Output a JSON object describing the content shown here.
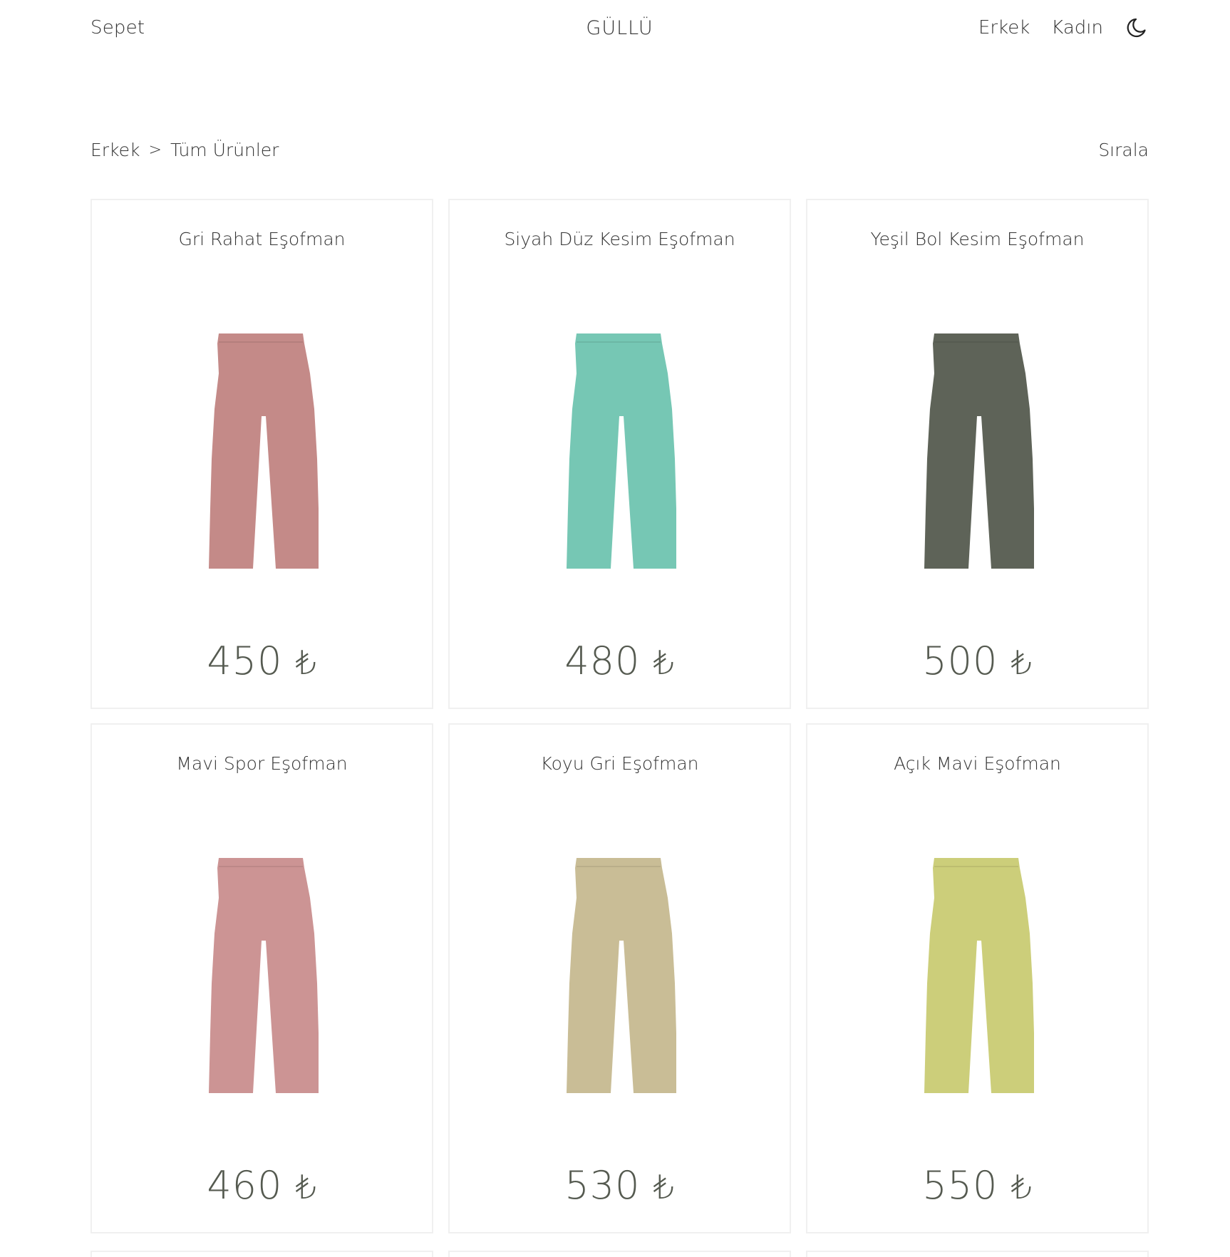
{
  "header": {
    "cart_label": "Sepet",
    "brand": "GÜLLÜ",
    "nav": [
      "Erkek",
      "Kadın"
    ],
    "theme_icon": "moon-icon"
  },
  "breadcrumb": {
    "items": [
      "Erkek",
      "Tüm Ürünler"
    ],
    "separator": ">"
  },
  "sort_label": "Sırala",
  "products": [
    {
      "name": "Gri Rahat Eşofman",
      "price": "450",
      "currency": "₺",
      "color": "#c48a88"
    },
    {
      "name": "Siyah Düz Kesim Eşofman",
      "price": "480",
      "currency": "₺",
      "color": "#76c7b4"
    },
    {
      "name": "Yeşil Bol Kesim Eşofman",
      "price": "500",
      "currency": "₺",
      "color": "#5e6358"
    },
    {
      "name": "Mavi Spor Eşofman",
      "price": "460",
      "currency": "₺",
      "color": "#cc9494"
    },
    {
      "name": "Koyu Gri Eşofman",
      "price": "530",
      "currency": "₺",
      "color": "#c9bd96"
    },
    {
      "name": "Açık Mavi Eşofman",
      "price": "550",
      "currency": "₺",
      "color": "#ccce7a"
    }
  ]
}
